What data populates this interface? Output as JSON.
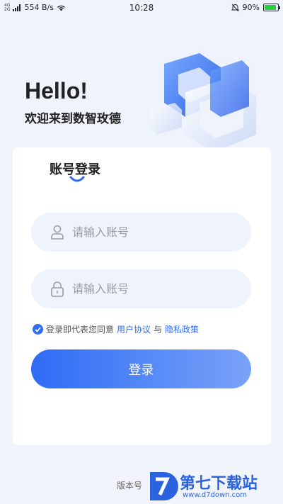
{
  "status_bar": {
    "signal_top": "4G",
    "signal_bottom": "2G",
    "net_speed": "554 B/s",
    "time": "10:28",
    "battery": "90%",
    "battery_level": 0.9
  },
  "hero": {
    "greeting": "Hello!",
    "welcome": "欢迎来到数智玫德"
  },
  "login": {
    "tab_label": "账号登录",
    "account_placeholder": "请输入账号",
    "password_placeholder": "请输入账号",
    "agreement_prefix": "登录即代表您同意",
    "user_agreement": "用户协议",
    "and": "与",
    "privacy_policy": "隐私政策",
    "submit_label": "登录"
  },
  "footer": {
    "version_label": "版本号"
  },
  "watermark": {
    "brand": "第七下载站",
    "url": "www.d7down.com"
  },
  "colors": {
    "accent": "#2f6bf5",
    "background": "#eef3fc"
  }
}
